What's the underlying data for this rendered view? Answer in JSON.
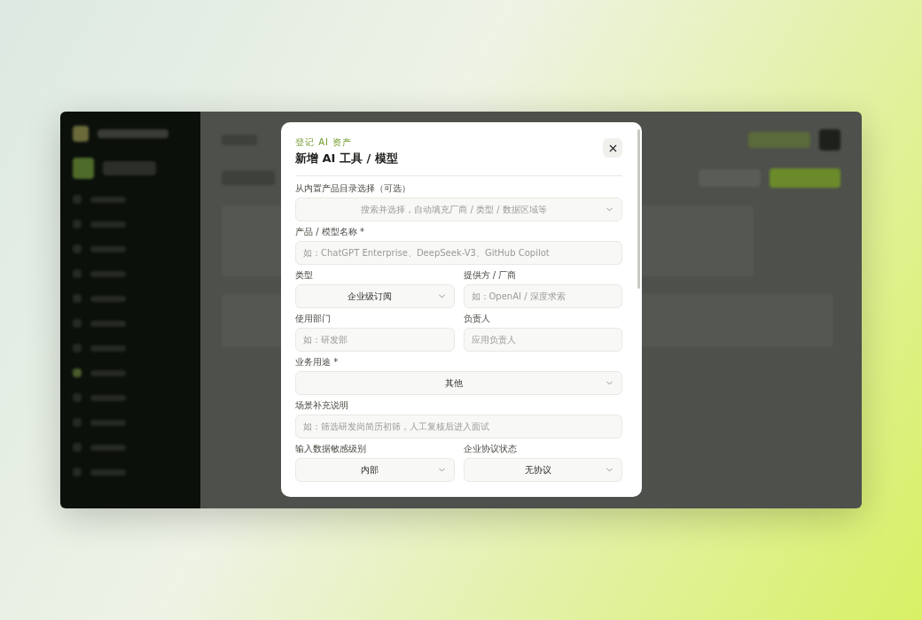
{
  "modal": {
    "eyebrow": "登记 AI 资产",
    "title": "新增 AI 工具 / 模型",
    "rows": [
      [
        {
          "kind": "select",
          "label": "从内置产品目录选择（可选）",
          "placeholder": "搜索并选择，自动填充厂商 / 类型 / 数据区域等"
        }
      ],
      [
        {
          "kind": "input",
          "label": "产品 / 模型名称 *",
          "placeholder": "如：ChatGPT Enterprise、DeepSeek-V3、GitHub Copilot"
        }
      ],
      [
        {
          "kind": "select",
          "label": "类型",
          "value": "企业级订阅"
        },
        {
          "kind": "input",
          "label": "提供方 / 厂商",
          "placeholder": "如：OpenAI / 深度求索"
        }
      ],
      [
        {
          "kind": "input",
          "label": "使用部门",
          "placeholder": "如：研发部"
        },
        {
          "kind": "input",
          "label": "负责人",
          "placeholder": "应用负责人"
        }
      ],
      [
        {
          "kind": "select",
          "label": "业务用途 *",
          "value": "其他"
        }
      ],
      [
        {
          "kind": "input",
          "label": "场景补充说明",
          "placeholder": "如：筛选研发岗简历初筛，人工复核后进入面试"
        }
      ],
      [
        {
          "kind": "select",
          "label": "输入数据敏感级别",
          "value": "内部"
        },
        {
          "kind": "select",
          "label": "企业协议状态",
          "value": "无协议"
        }
      ]
    ]
  }
}
